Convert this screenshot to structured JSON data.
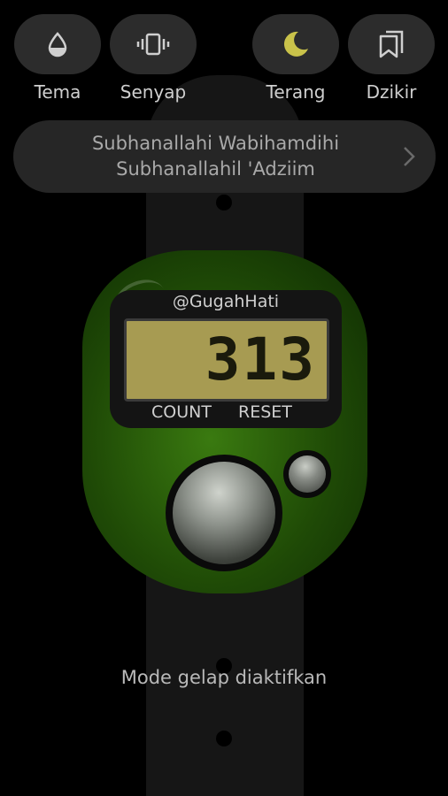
{
  "toolbar": {
    "theme_label": "Tema",
    "silent_label": "Senyap",
    "light_label": "Terang",
    "dzikir_label": "Dzikir"
  },
  "dzikir": {
    "line1": "Subhanallahi Wabihamdihi",
    "line2": "Subhanallahil 'Adziim"
  },
  "counter": {
    "brand": "@GugahHati",
    "value": "313",
    "count_label": "COUNT",
    "reset_label": "RESET"
  },
  "toast": "Mode gelap diaktifkan",
  "colors": {
    "moon_accent": "#c9c24a",
    "lcd": "#a79b52",
    "device_green": "#3a7a10"
  }
}
